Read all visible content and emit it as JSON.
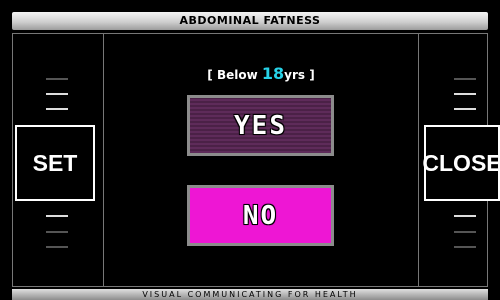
{
  "header": {
    "title": "ABDOMINAL  FATNESS"
  },
  "prompt": {
    "prefix": "[ Below ",
    "age": "18",
    "suffix": "yrs ]"
  },
  "buttons": {
    "set": "SET",
    "close": "CLOSE",
    "yes": "YES",
    "no": "NO"
  },
  "footer": {
    "tagline": "VISUAL  COMMUNICATING  FOR  HEALTH"
  },
  "colors": {
    "accent": "#27d3e8",
    "yes_bg": "#5e2b5a",
    "no_bg": "#ee16d4",
    "frame": "#777777"
  }
}
